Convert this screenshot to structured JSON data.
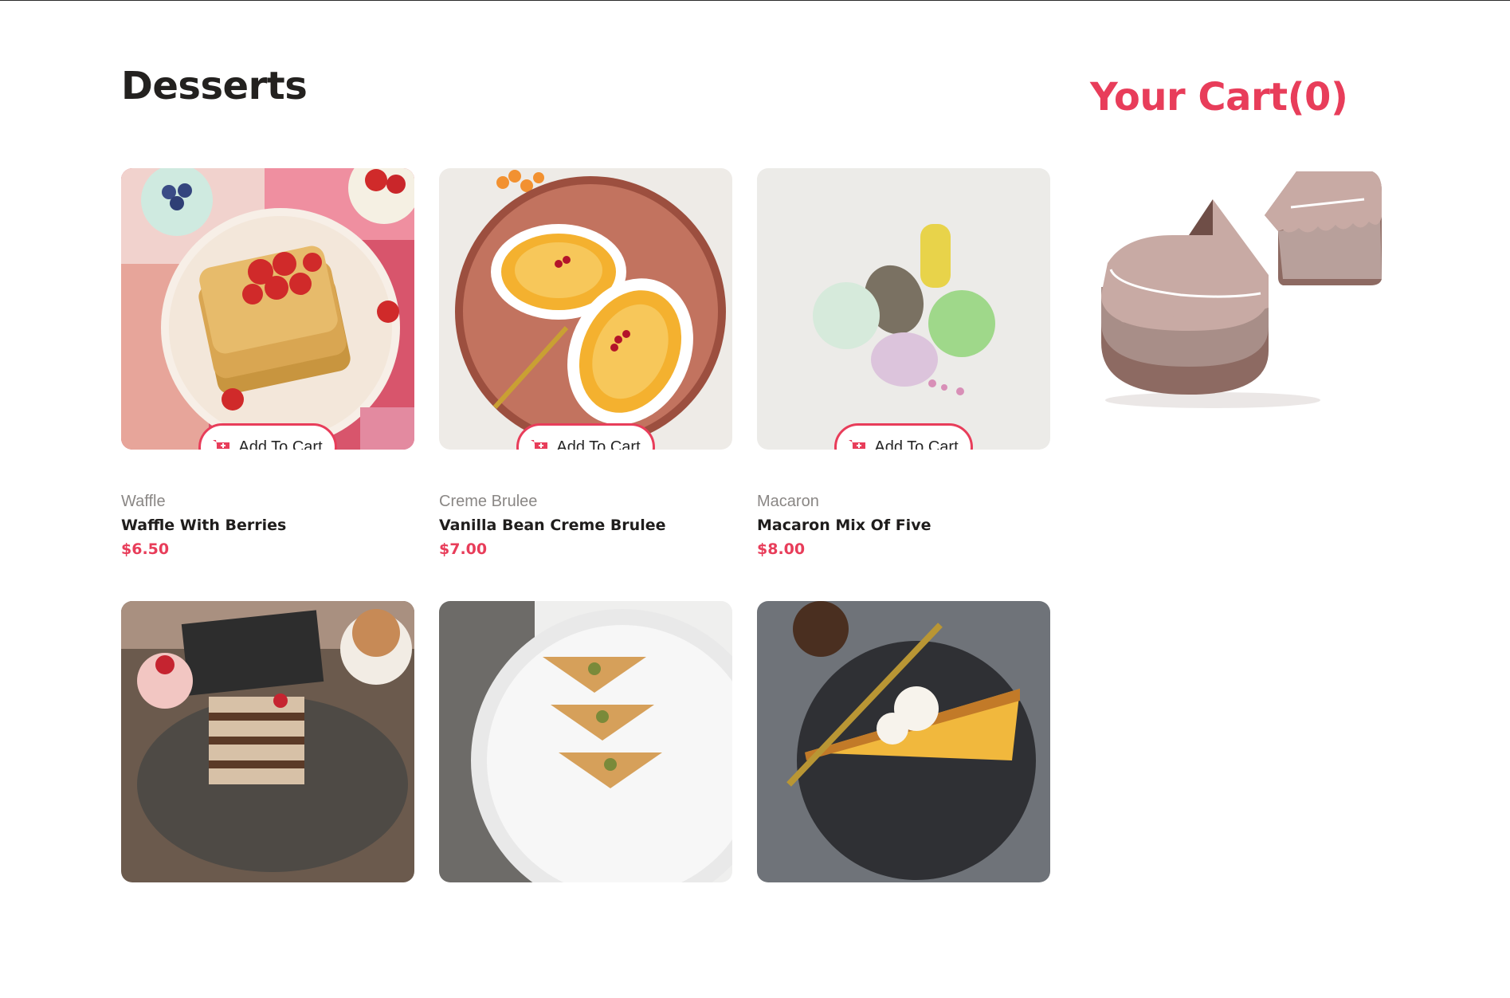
{
  "page": {
    "title": "Desserts"
  },
  "cart": {
    "title": "Your Cart(0)",
    "illustration_icon": "cake-icon"
  },
  "colors": {
    "accent": "#e83d5a",
    "heading": "#23211f",
    "muted": "#8a8785"
  },
  "products": [
    {
      "category": "Waffle",
      "name": "Waffle With Berries",
      "price": "$6.50",
      "button": "Add To Cart"
    },
    {
      "category": "Creme Brulee",
      "name": "Vanilla Bean Creme Brulee",
      "price": "$7.00",
      "button": "Add To Cart"
    },
    {
      "category": "Macaron",
      "name": "Macaron Mix Of Five",
      "price": "$8.00",
      "button": "Add To Cart"
    },
    {
      "category": "",
      "name": "",
      "price": "",
      "button": ""
    },
    {
      "category": "",
      "name": "",
      "price": "",
      "button": ""
    },
    {
      "category": "",
      "name": "",
      "price": "",
      "button": ""
    }
  ]
}
